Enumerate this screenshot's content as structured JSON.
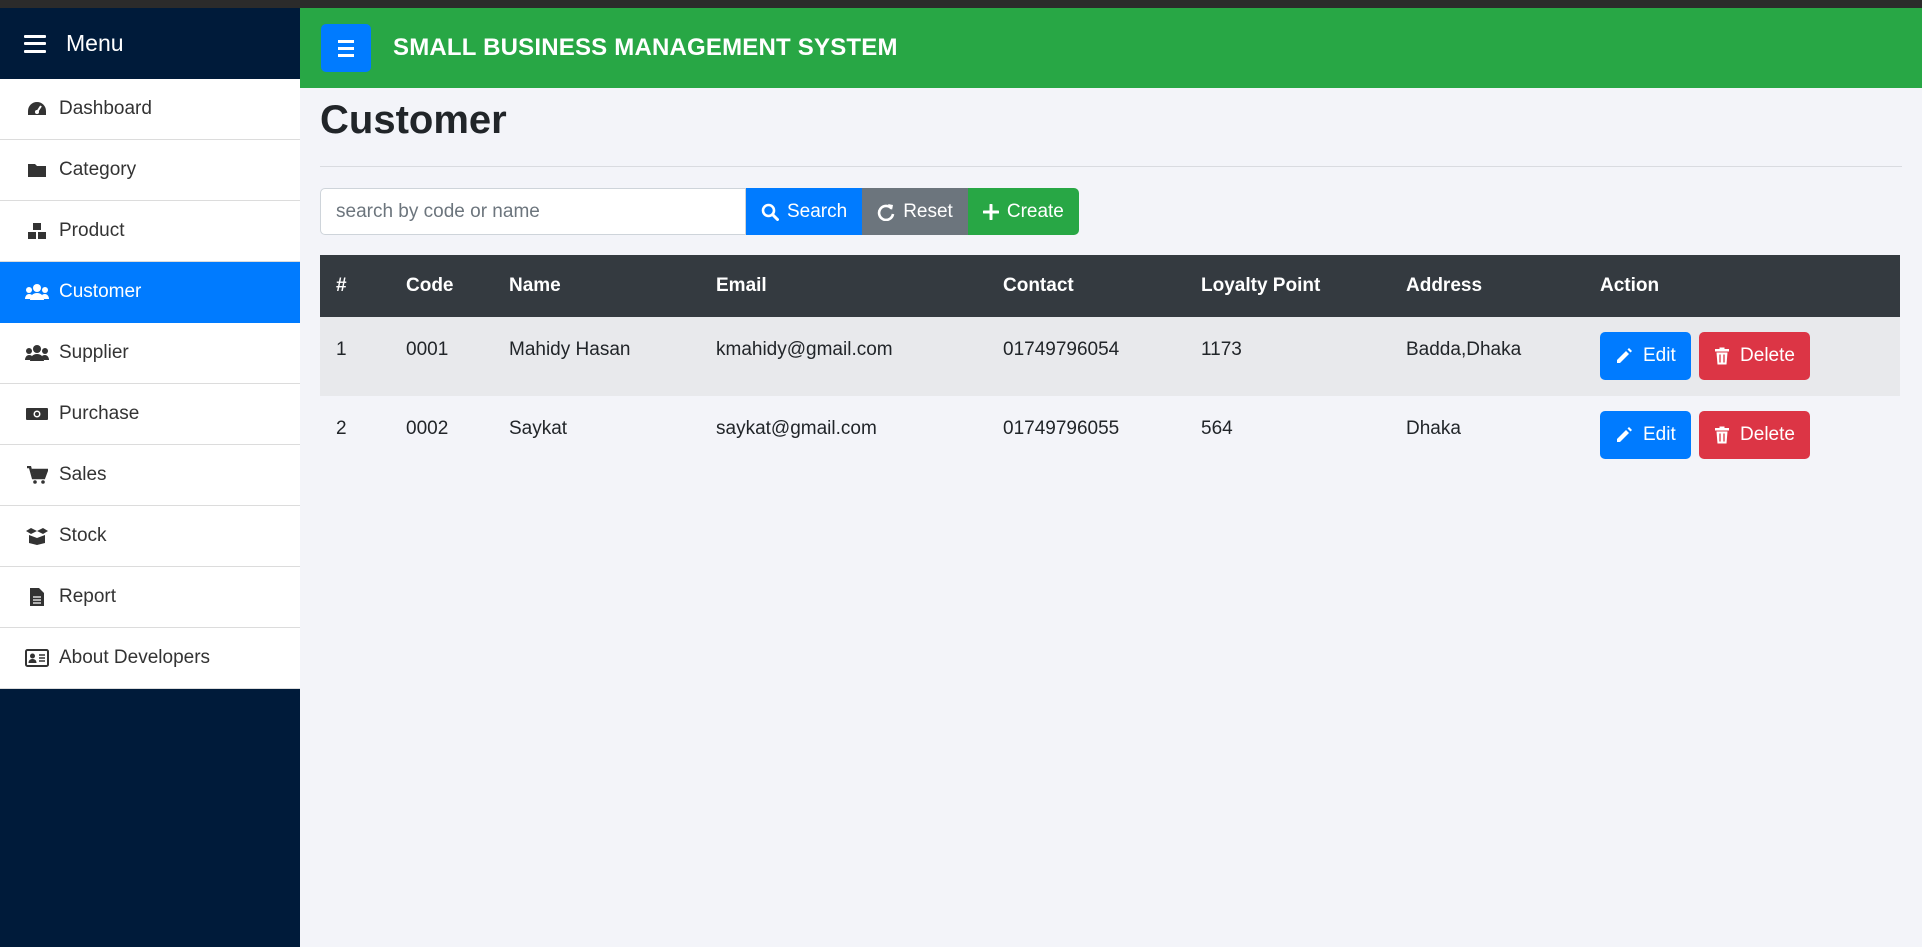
{
  "sidebar": {
    "title": "Menu",
    "items": [
      {
        "label": "Dashboard",
        "icon": "tachometer-icon",
        "active": false
      },
      {
        "label": "Category",
        "icon": "folder-icon",
        "active": false
      },
      {
        "label": "Product",
        "icon": "boxes-icon",
        "active": false
      },
      {
        "label": "Customer",
        "icon": "users-icon",
        "active": true
      },
      {
        "label": "Supplier",
        "icon": "users-icon",
        "active": false
      },
      {
        "label": "Purchase",
        "icon": "money-bill-icon",
        "active": false
      },
      {
        "label": "Sales",
        "icon": "cart-icon",
        "active": false
      },
      {
        "label": "Stock",
        "icon": "box-open-icon",
        "active": false
      },
      {
        "label": "Report",
        "icon": "file-icon",
        "active": false
      },
      {
        "label": "About Developers",
        "icon": "id-card-icon",
        "active": false
      }
    ]
  },
  "header": {
    "title": "SMALL BUSINESS MANAGEMENT SYSTEM"
  },
  "main": {
    "page_title": "Customer",
    "search": {
      "placeholder": "search by code or name",
      "value": ""
    },
    "buttons": {
      "search": "Search",
      "reset": "Reset",
      "create": "Create"
    },
    "table": {
      "columns": [
        "#",
        "Code",
        "Name",
        "Email",
        "Contact",
        "Loyalty Point",
        "Address",
        "Action"
      ],
      "rows": [
        {
          "num": "1",
          "code": "0001",
          "name": "Mahidy Hasan",
          "email": "kmahidy@gmail.com",
          "contact": "01749796054",
          "loyalty": "1173",
          "address": "Badda,Dhaka"
        },
        {
          "num": "2",
          "code": "0002",
          "name": "Saykat",
          "email": "saykat@gmail.com",
          "contact": "01749796055",
          "loyalty": "564",
          "address": "Dhaka"
        }
      ],
      "edit_label": "Edit",
      "delete_label": "Delete"
    }
  },
  "colors": {
    "sidebar_bg": "#001b3a",
    "header_bg": "#28a745",
    "primary": "#007bff",
    "danger": "#dc3545",
    "secondary": "#6c757d",
    "table_head": "#343a40"
  }
}
